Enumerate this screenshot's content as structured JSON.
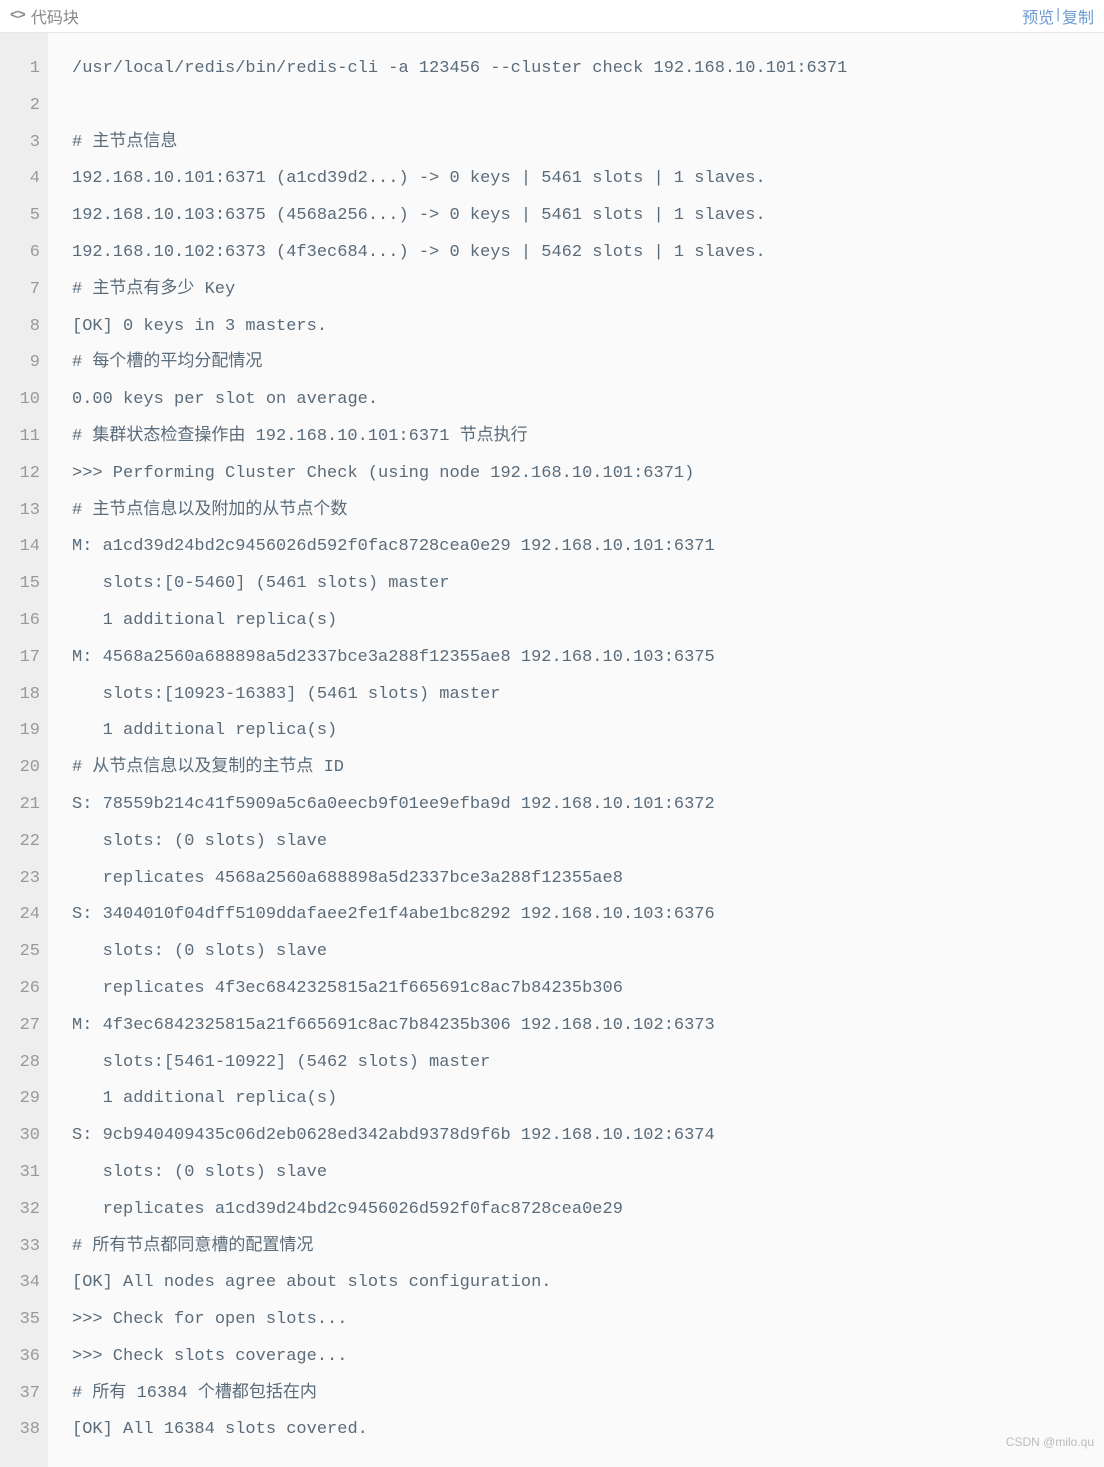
{
  "header": {
    "title": "代码块",
    "preview_label": "预览",
    "copy_label": "复制"
  },
  "code": {
    "lines": [
      "/usr/local/redis/bin/redis-cli -a 123456 --cluster check 192.168.10.101:6371",
      "",
      "# 主节点信息",
      "192.168.10.101:6371 (a1cd39d2...) -> 0 keys | 5461 slots | 1 slaves.",
      "192.168.10.103:6375 (4568a256...) -> 0 keys | 5461 slots | 1 slaves.",
      "192.168.10.102:6373 (4f3ec684...) -> 0 keys | 5462 slots | 1 slaves.",
      "# 主节点有多少 Key",
      "[OK] 0 keys in 3 masters.",
      "# 每个槽的平均分配情况",
      "0.00 keys per slot on average.",
      "# 集群状态检查操作由 192.168.10.101:6371 节点执行",
      ">>> Performing Cluster Check (using node 192.168.10.101:6371)",
      "# 主节点信息以及附加的从节点个数",
      "M: a1cd39d24bd2c9456026d592f0fac8728cea0e29 192.168.10.101:6371",
      "   slots:[0-5460] (5461 slots) master",
      "   1 additional replica(s)",
      "M: 4568a2560a688898a5d2337bce3a288f12355ae8 192.168.10.103:6375",
      "   slots:[10923-16383] (5461 slots) master",
      "   1 additional replica(s)",
      "# 从节点信息以及复制的主节点 ID",
      "S: 78559b214c41f5909a5c6a0eecb9f01ee9efba9d 192.168.10.101:6372",
      "   slots: (0 slots) slave",
      "   replicates 4568a2560a688898a5d2337bce3a288f12355ae8",
      "S: 3404010f04dff5109ddafaee2fe1f4abe1bc8292 192.168.10.103:6376",
      "   slots: (0 slots) slave",
      "   replicates 4f3ec6842325815a21f665691c8ac7b84235b306",
      "M: 4f3ec6842325815a21f665691c8ac7b84235b306 192.168.10.102:6373",
      "   slots:[5461-10922] (5462 slots) master",
      "   1 additional replica(s)",
      "S: 9cb940409435c06d2eb0628ed342abd9378d9f6b 192.168.10.102:6374",
      "   slots: (0 slots) slave",
      "   replicates a1cd39d24bd2c9456026d592f0fac8728cea0e29",
      "# 所有节点都同意槽的配置情况",
      "[OK] All nodes agree about slots configuration.",
      ">>> Check for open slots...",
      ">>> Check slots coverage...",
      "# 所有 16384 个槽都包括在内",
      "[OK] All 16384 slots covered."
    ]
  },
  "watermark": "CSDN @milo.qu"
}
